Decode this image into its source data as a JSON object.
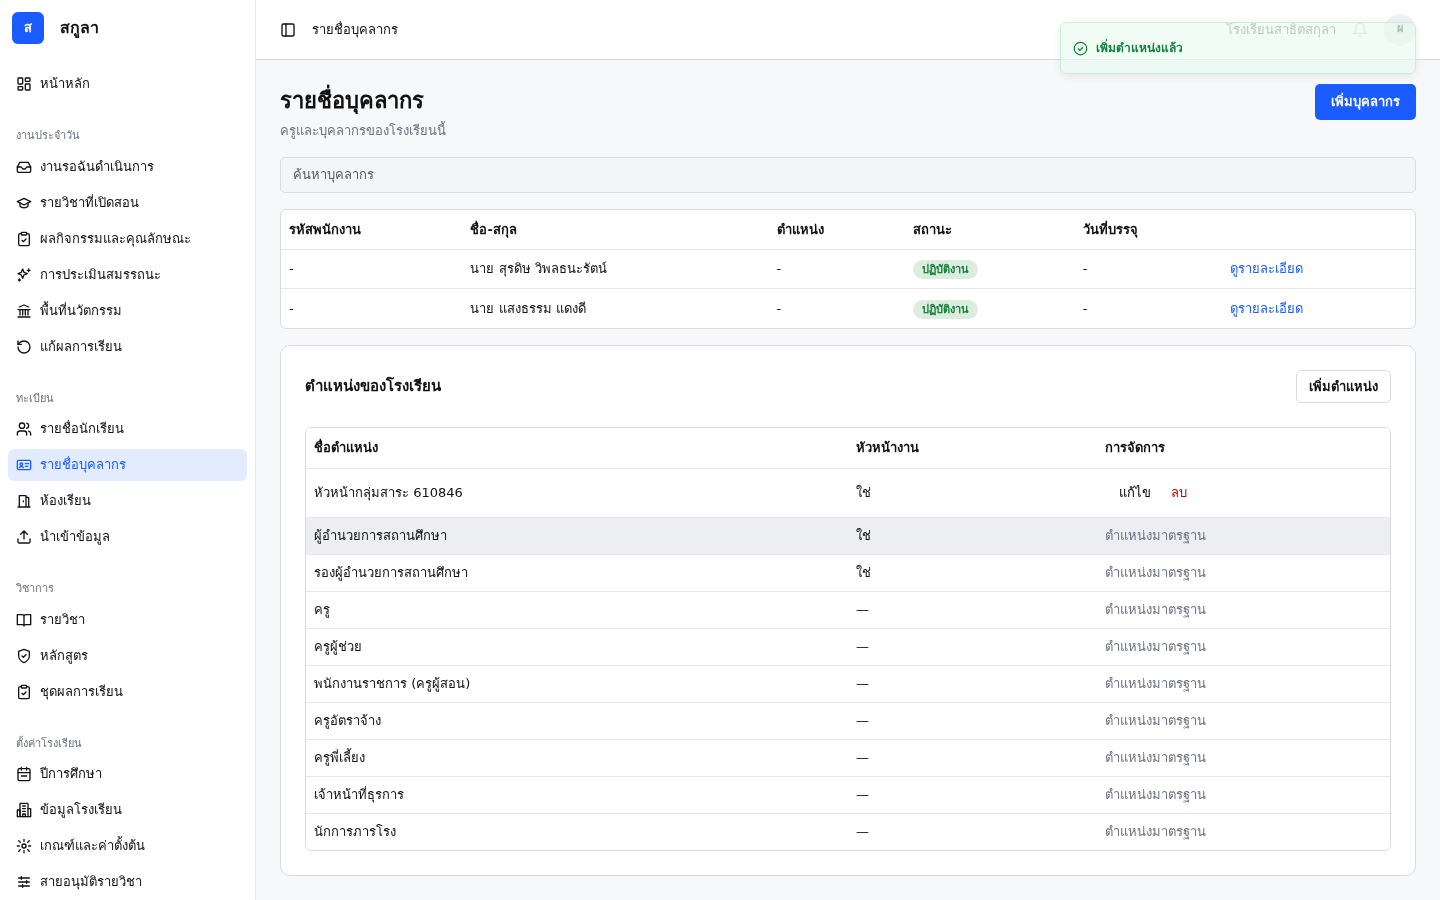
{
  "brand": {
    "logo": "ส",
    "name": "สกูลา"
  },
  "sidebar": {
    "sections": [
      {
        "items": [
          {
            "label": "หน้าหลัก",
            "selected": false
          }
        ]
      },
      {
        "title": "งานประจำวัน",
        "items": [
          {
            "label": "งานรอฉันดำเนินการ",
            "selected": false
          },
          {
            "label": "รายวิชาที่เปิดสอน",
            "selected": false
          },
          {
            "label": "ผลกิจกรรมและคุณลักษณะ",
            "selected": false
          },
          {
            "label": "การประเมินสมรรถนะ",
            "selected": false
          },
          {
            "label": "พื้นที่นวัตกรรม",
            "selected": false
          },
          {
            "label": "แก้ผลการเรียน",
            "selected": false
          }
        ]
      },
      {
        "title": "ทะเบียน",
        "items": [
          {
            "label": "รายชื่อนักเรียน",
            "selected": false
          },
          {
            "label": "รายชื่อบุคลากร",
            "selected": true
          },
          {
            "label": "ห้องเรียน",
            "selected": false
          },
          {
            "label": "นำเข้าข้อมูล",
            "selected": false
          }
        ]
      },
      {
        "title": "วิชาการ",
        "items": [
          {
            "label": "รายวิชา",
            "selected": false
          },
          {
            "label": "หลักสูตร",
            "selected": false
          },
          {
            "label": "ชุดผลการเรียน",
            "selected": false
          }
        ]
      },
      {
        "title": "ตั้งค่าโรงเรียน",
        "items": [
          {
            "label": "ปีการศึกษา",
            "selected": false
          },
          {
            "label": "ข้อมูลโรงเรียน",
            "selected": false
          },
          {
            "label": "เกณฑ์และค่าตั้งต้น",
            "selected": false
          },
          {
            "label": "สายอนุมัติรายวิชา",
            "selected": false
          }
        ]
      }
    ]
  },
  "header": {
    "breadcrumb": "รายชื่อบุคลากร",
    "school": "โรงเรียนสาธิตสกุลา",
    "avatar": "ผ"
  },
  "toast": {
    "message": "เพิ่มตำแหน่งแล้ว"
  },
  "page": {
    "title": "รายชื่อบุคลากร",
    "subtitle": "ครูและบุคลากรของโรงเรียนนี้",
    "add_button": "เพิ่มบุคลากร",
    "search": {
      "placeholder": "ค้นหาบุคลากร"
    }
  },
  "staff_table": {
    "columns": [
      "รหัสพนักงาน",
      "ชื่อ-สกุล",
      "ตำแหน่ง",
      "สถานะ",
      "วันที่บรรจุ"
    ],
    "rows": [
      {
        "id": "-",
        "name": "นาย สุรดิษ วิพลธนะรัตน์",
        "position": "-",
        "status": "ปฏิบัติงาน",
        "start_date": "-",
        "link": "ดูรายละเอียด"
      },
      {
        "id": "-",
        "name": "นาย แสงธรรม แดงดี",
        "position": "-",
        "status": "ปฏิบัติงาน",
        "start_date": "-",
        "link": "ดูรายละเอียด"
      }
    ]
  },
  "positions": {
    "title": "ตำแหน่งของโรงเรียน",
    "add_button": "เพิ่มตำแหน่ง",
    "columns": [
      "ชื่อตำแหน่ง",
      "หัวหน้างาน",
      "การจัดการ"
    ],
    "rows": [
      {
        "kind": "custom",
        "name": "หัวหน้ากลุ่มสาระ 610846",
        "head": "ใช่",
        "edit": "แก้ไข",
        "delete": "ลบ",
        "hovered": false
      },
      {
        "kind": "standard",
        "name": "ผู้อำนวยการสถานศึกษา",
        "head": "ใช่",
        "note": "ตำแหน่งมาตรฐาน",
        "hovered": true
      },
      {
        "kind": "standard",
        "name": "รองผู้อำนวยการสถานศึกษา",
        "head": "ใช่",
        "note": "ตำแหน่งมาตรฐาน",
        "hovered": false
      },
      {
        "kind": "standard",
        "name": "ครู",
        "head": "—",
        "note": "ตำแหน่งมาตรฐาน",
        "hovered": false
      },
      {
        "kind": "standard",
        "name": "ครูผู้ช่วย",
        "head": "—",
        "note": "ตำแหน่งมาตรฐาน",
        "hovered": false
      },
      {
        "kind": "standard",
        "name": "พนักงานราชการ (ครูผู้สอน)",
        "head": "—",
        "note": "ตำแหน่งมาตรฐาน",
        "hovered": false
      },
      {
        "kind": "standard",
        "name": "ครูอัตราจ้าง",
        "head": "—",
        "note": "ตำแหน่งมาตรฐาน",
        "hovered": false
      },
      {
        "kind": "standard",
        "name": "ครูพี่เลี้ยง",
        "head": "—",
        "note": "ตำแหน่งมาตรฐาน",
        "hovered": false
      },
      {
        "kind": "standard",
        "name": "เจ้าหน้าที่ธุรการ",
        "head": "—",
        "note": "ตำแหน่งมาตรฐาน",
        "hovered": false
      },
      {
        "kind": "standard",
        "name": "นักการภารโรง",
        "head": "—",
        "note": "ตำแหน่งมาตรฐาน",
        "hovered": false
      }
    ]
  }
}
